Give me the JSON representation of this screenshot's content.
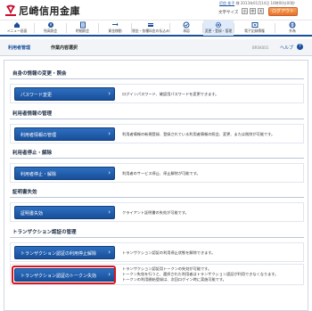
{
  "header": {
    "bank_name": "尼崎信用金庫",
    "user_name": "尼信 花子",
    "user_suffix": "様",
    "last_login": "2013年01月14日 10時00分00秒",
    "font_size_label": "文字サイズ",
    "font_buttons": [
      "小",
      "中",
      "大"
    ],
    "logout_label": "ログアウト"
  },
  "menu": [
    {
      "label": "メニュー画面",
      "icon": "home-icon"
    },
    {
      "label": "残高照会",
      "icon": "balance-icon"
    },
    {
      "label": "明細照会",
      "icon": "statement-icon"
    },
    {
      "label": "資金移動",
      "icon": "transfer-icon"
    },
    {
      "label": "税金・各種料金の払込み",
      "icon": "payment-icon"
    },
    {
      "label": "承認",
      "icon": "approve-icon"
    },
    {
      "label": "変更・登録・管理",
      "icon": "settings-icon"
    },
    {
      "label": "電子記録債権",
      "icon": "bond-icon"
    },
    {
      "label": "外為",
      "icon": "foreign-exchange-icon"
    }
  ],
  "breadcrumb": {
    "crumb1": "利用者管理",
    "crumb2": "作業内容選択",
    "screen_id": "BRSK001",
    "help": "ヘルプ",
    "help_icon": "?"
  },
  "sections": [
    {
      "title": "自身の情報の変更・照会",
      "rows": [
        {
          "button": "パスワード変更",
          "desc": [
            "ログインパスワード、確認用パスワードを変更できます。"
          ]
        }
      ]
    },
    {
      "title": "利用者情報の管理",
      "rows": [
        {
          "button": "利用者情報の管理",
          "desc": [
            "利用者情報の新規登録、登録されている利用者情報の照会、変更、または削除が可能です。"
          ]
        }
      ]
    },
    {
      "title": "利用者停止・解除",
      "rows": [
        {
          "button": "利用者停止・解除",
          "desc": [
            "利用者のサービス停止、停止解除が可能です。"
          ]
        }
      ]
    },
    {
      "title": "証明書失効",
      "rows": [
        {
          "button": "証明書失効",
          "desc": [
            "クライアント証明書の失効が可能です。"
          ]
        }
      ]
    },
    {
      "title": "トランザクション認証の管理",
      "rows": [
        {
          "button": "トランザクション認証の利用停止解除",
          "desc": [
            "トランザクション認証の利用停止状態を解除できます。"
          ]
        },
        {
          "button": "トランザクション認証のトークン失効",
          "desc": [
            "トランザクション認証用トークンの失効が可能です。",
            "トークン失効を行うと、選択された利用者はトランザクション認証が利用できなくなります。",
            "トークンの利用開始登録は、次回ログイン時に実施可能です。"
          ]
        }
      ]
    }
  ],
  "chevron": "›",
  "colors": {
    "accent": "#1a4f9c",
    "highlight": "#d8141f",
    "brand": "#c8102e"
  }
}
